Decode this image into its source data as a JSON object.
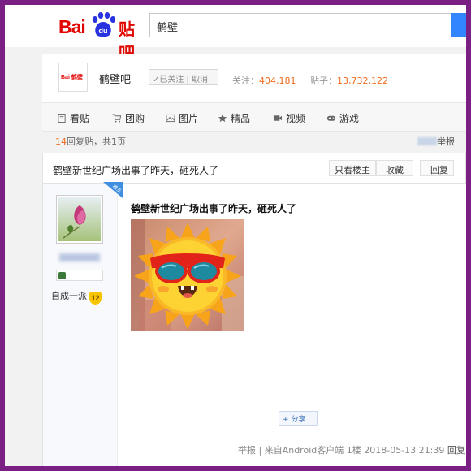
{
  "header": {
    "logo_bai": "Bai",
    "logo_du": "du",
    "logo_tieba": "贴吧",
    "search_value": "鹤壁"
  },
  "forum": {
    "avatar_text": "Bai 鹤壁",
    "name": "鹤壁吧",
    "follow_label": "✓已关注 | 取消",
    "followers_label": "关注：",
    "followers_value": "404,181",
    "posts_label": "贴子：",
    "posts_value": "13,732,122"
  },
  "nav": {
    "items": [
      {
        "label": "看贴",
        "icon": "document-icon"
      },
      {
        "label": "团购",
        "icon": "cart-icon"
      },
      {
        "label": "图片",
        "icon": "image-icon"
      },
      {
        "label": "精品",
        "icon": "star-icon"
      },
      {
        "label": "视频",
        "icon": "video-icon"
      },
      {
        "label": "游戏",
        "icon": "gamepad-icon"
      }
    ]
  },
  "thread": {
    "reply_count": "14",
    "reply_suffix": "回复贴，共1页",
    "report_label": "举报",
    "title": "鹤壁新世纪广场出事了昨天，砸死人了",
    "btn_only_op": "只看楼主",
    "btn_collect": "收藏",
    "btn_reply": "回复"
  },
  "post": {
    "op_tag": "楼主",
    "author_level_name": "自成一派",
    "author_level": "12",
    "title": "鹤壁新世纪广场出事了昨天，砸死人了",
    "share_label": "+ 分享",
    "report": "举报",
    "source": "| 来自Android客户端",
    "floor": "1楼",
    "datetime": "2018-05-13 21:39",
    "reply": "回复"
  }
}
